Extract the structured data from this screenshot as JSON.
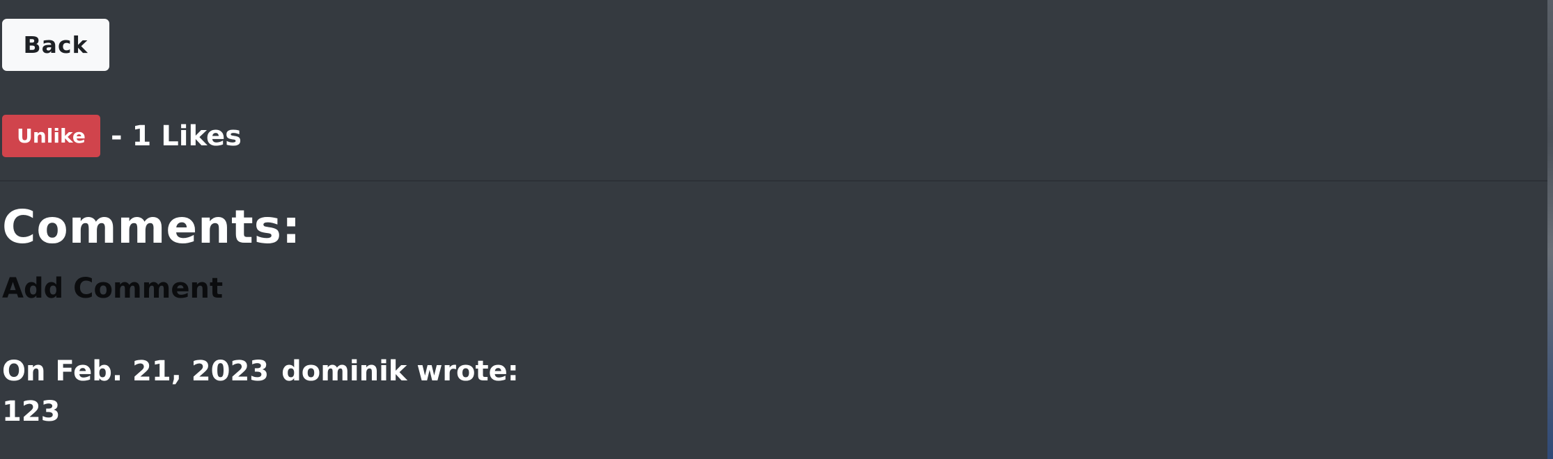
{
  "actions": {
    "back_label": "Back",
    "unlike_label": "Unlike",
    "likes_text": "- 1 Likes"
  },
  "comments": {
    "heading": "Comments:",
    "add_label": "Add Comment",
    "items": [
      {
        "date_prefix": "On Feb. 21, 2023",
        "author_suffix": "dominik wrote:",
        "body": "123"
      }
    ]
  },
  "colors": {
    "background": "#353a40",
    "back_button": "#f8f9fa",
    "unlike_button": "#d0444c",
    "add_comment_link": "#0b0c0e"
  }
}
